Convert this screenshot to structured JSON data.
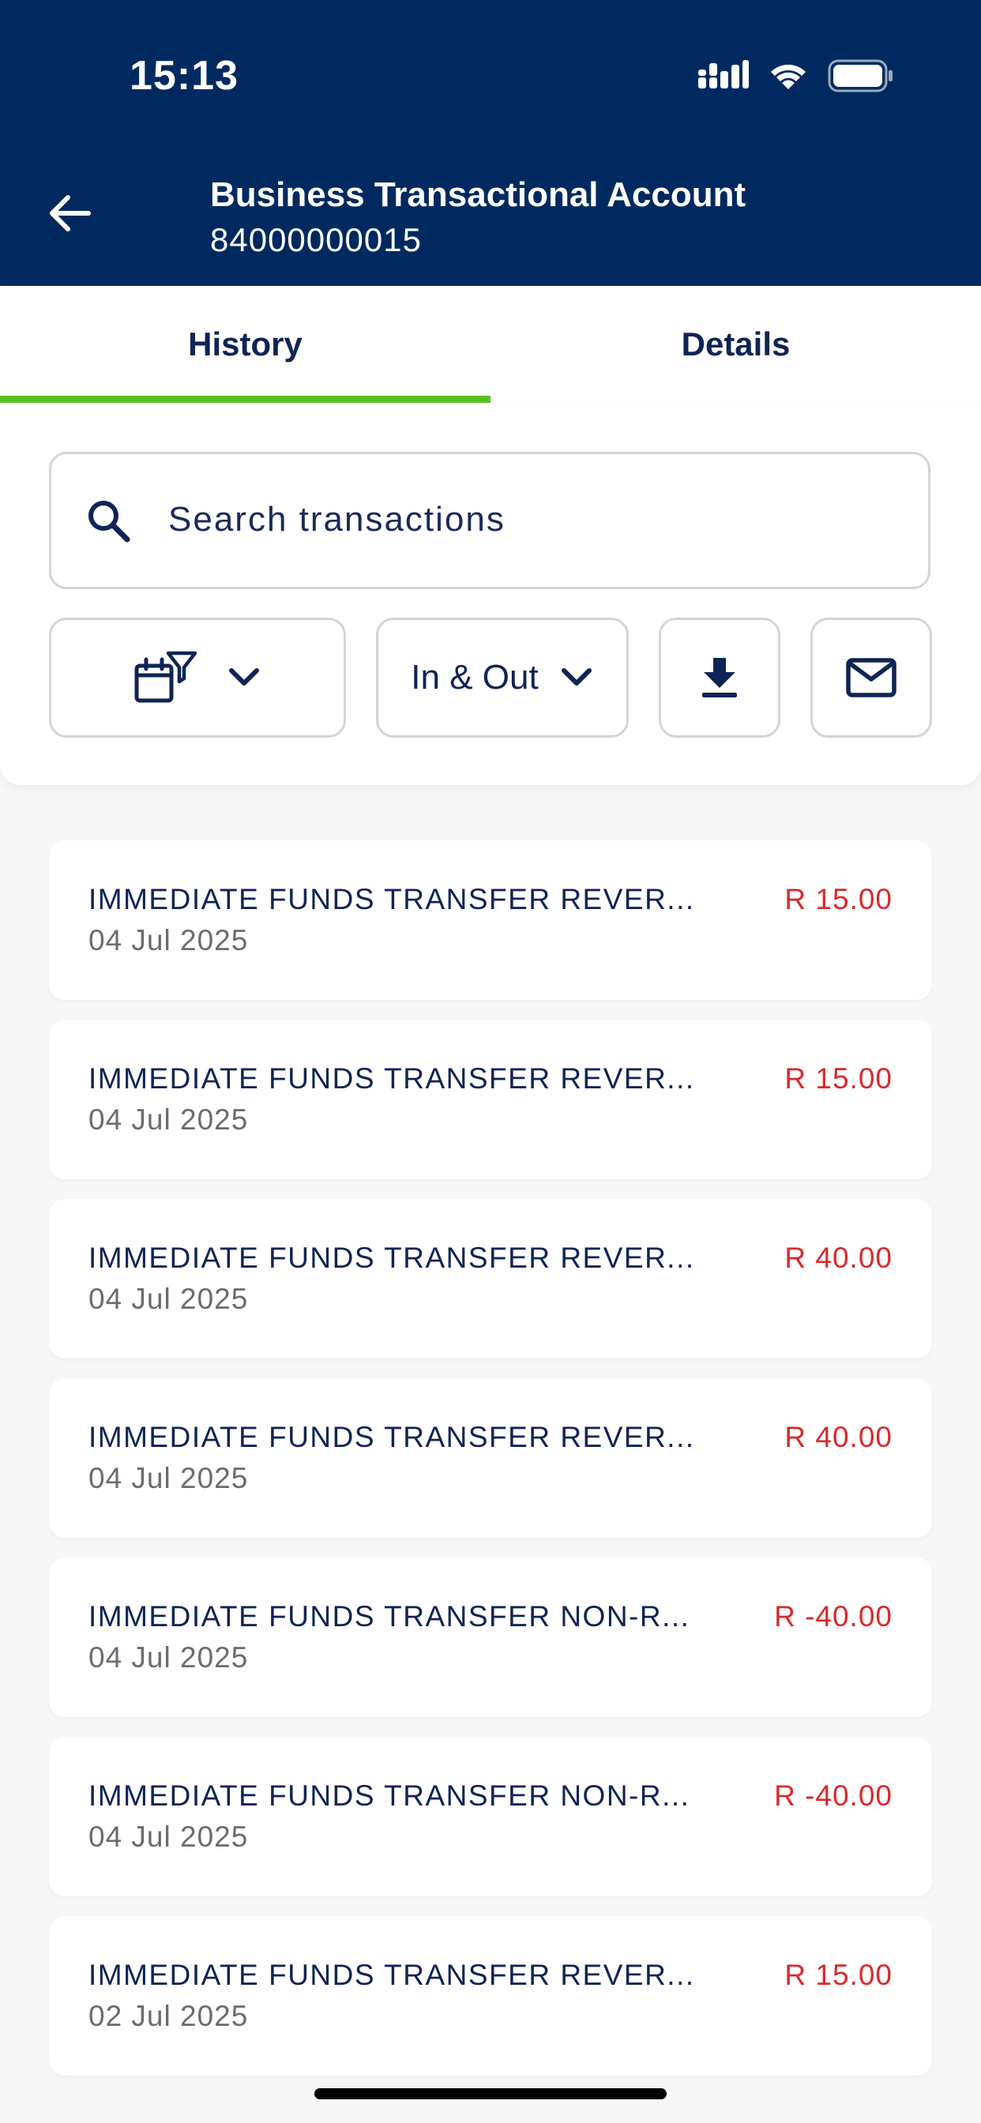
{
  "status_bar": {
    "time": "15:13"
  },
  "header": {
    "title": "Business Transactional Account",
    "account_number": "84000000015"
  },
  "tabs": [
    {
      "label": "History",
      "active": true
    },
    {
      "label": "Details",
      "active": false
    }
  ],
  "search": {
    "placeholder": "Search transactions"
  },
  "filters": {
    "direction_label": "In & Out"
  },
  "transactions": [
    {
      "description": "IMMEDIATE FUNDS TRANSFER REVER...",
      "date": "04 Jul 2025",
      "amount": "R 15.00"
    },
    {
      "description": "IMMEDIATE FUNDS TRANSFER REVER...",
      "date": "04 Jul 2025",
      "amount": "R 15.00"
    },
    {
      "description": "IMMEDIATE FUNDS TRANSFER REVER...",
      "date": "04 Jul 2025",
      "amount": "R 40.00"
    },
    {
      "description": "IMMEDIATE FUNDS TRANSFER REVER...",
      "date": "04 Jul 2025",
      "amount": "R 40.00"
    },
    {
      "description": "IMMEDIATE FUNDS TRANSFER NON-R...",
      "date": "04 Jul 2025",
      "amount": "R -40.00"
    },
    {
      "description": "IMMEDIATE FUNDS TRANSFER NON-R...",
      "date": "04 Jul 2025",
      "amount": "R -40.00"
    },
    {
      "description": "IMMEDIATE FUNDS TRANSFER REVER...",
      "date": "02 Jul 2025",
      "amount": "R 15.00"
    }
  ],
  "colors": {
    "header_bg": "#002a5f",
    "tab_indicator": "#5ac21f",
    "amount_text": "#d9292b",
    "primary_text": "#0f2455"
  },
  "icons": [
    "back-arrow-icon",
    "signal-icon",
    "wifi-icon",
    "battery-icon",
    "search-icon",
    "calendar-filter-icon",
    "chevron-down-icon",
    "download-icon",
    "envelope-icon"
  ]
}
